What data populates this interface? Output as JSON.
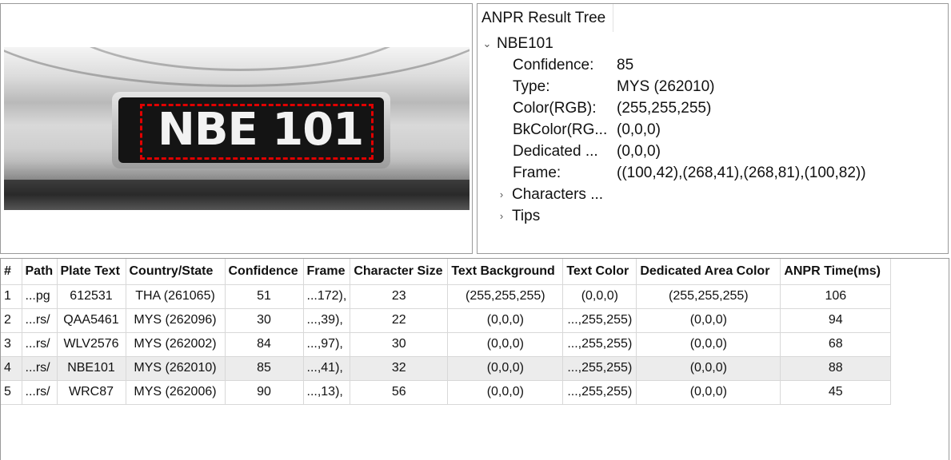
{
  "tree": {
    "header": "ANPR Result Tree",
    "root_label": "NBE101",
    "fields": [
      {
        "label": "Confidence:",
        "value": "85"
      },
      {
        "label": "Type:",
        "value": "MYS (262010)"
      },
      {
        "label": "Color(RGB):",
        "value": "(255,255,255)"
      },
      {
        "label": "BkColor(RG...",
        "value": "(0,0,0)"
      },
      {
        "label": "Dedicated ...",
        "value": "(0,0,0)"
      },
      {
        "label": "Frame:",
        "value": "((100,42),(268,41),(268,81),(100,82))"
      }
    ],
    "collapsed_nodes": [
      {
        "label": "Characters ..."
      },
      {
        "label": "Tips"
      }
    ]
  },
  "image": {
    "plate_text": "NBE 101",
    "box_color": "#e00000"
  },
  "table": {
    "columns": [
      "#",
      "Path",
      "Plate Text",
      "Country/State",
      "Confidence",
      "Frame",
      "Character Size",
      "Text Background",
      "Text Color",
      "Dedicated Area Color",
      "ANPR Time(ms)"
    ],
    "rows": [
      [
        "1",
        "...pg",
        "612531",
        "THA (261065)",
        "51",
        "...172),",
        "23",
        "(255,255,255)",
        "(0,0,0)",
        "(255,255,255)",
        "106"
      ],
      [
        "2",
        "...rs/",
        "QAA5461",
        "MYS (262096)",
        "30",
        "...,39),",
        "22",
        "(0,0,0)",
        "...,255,255)",
        "(0,0,0)",
        "94"
      ],
      [
        "3",
        "...rs/",
        "WLV2576",
        "MYS (262002)",
        "84",
        "...,97),",
        "30",
        "(0,0,0)",
        "...,255,255)",
        "(0,0,0)",
        "68"
      ],
      [
        "4",
        "...rs/",
        "NBE101",
        "MYS (262010)",
        "85",
        "...,41),",
        "32",
        "(0,0,0)",
        "...,255,255)",
        "(0,0,0)",
        "88"
      ],
      [
        "5",
        "...rs/",
        "WRC87",
        "MYS (262006)",
        "90",
        "...,13),",
        "56",
        "(0,0,0)",
        "...,255,255)",
        "(0,0,0)",
        "45"
      ]
    ],
    "selected_row": 4
  }
}
